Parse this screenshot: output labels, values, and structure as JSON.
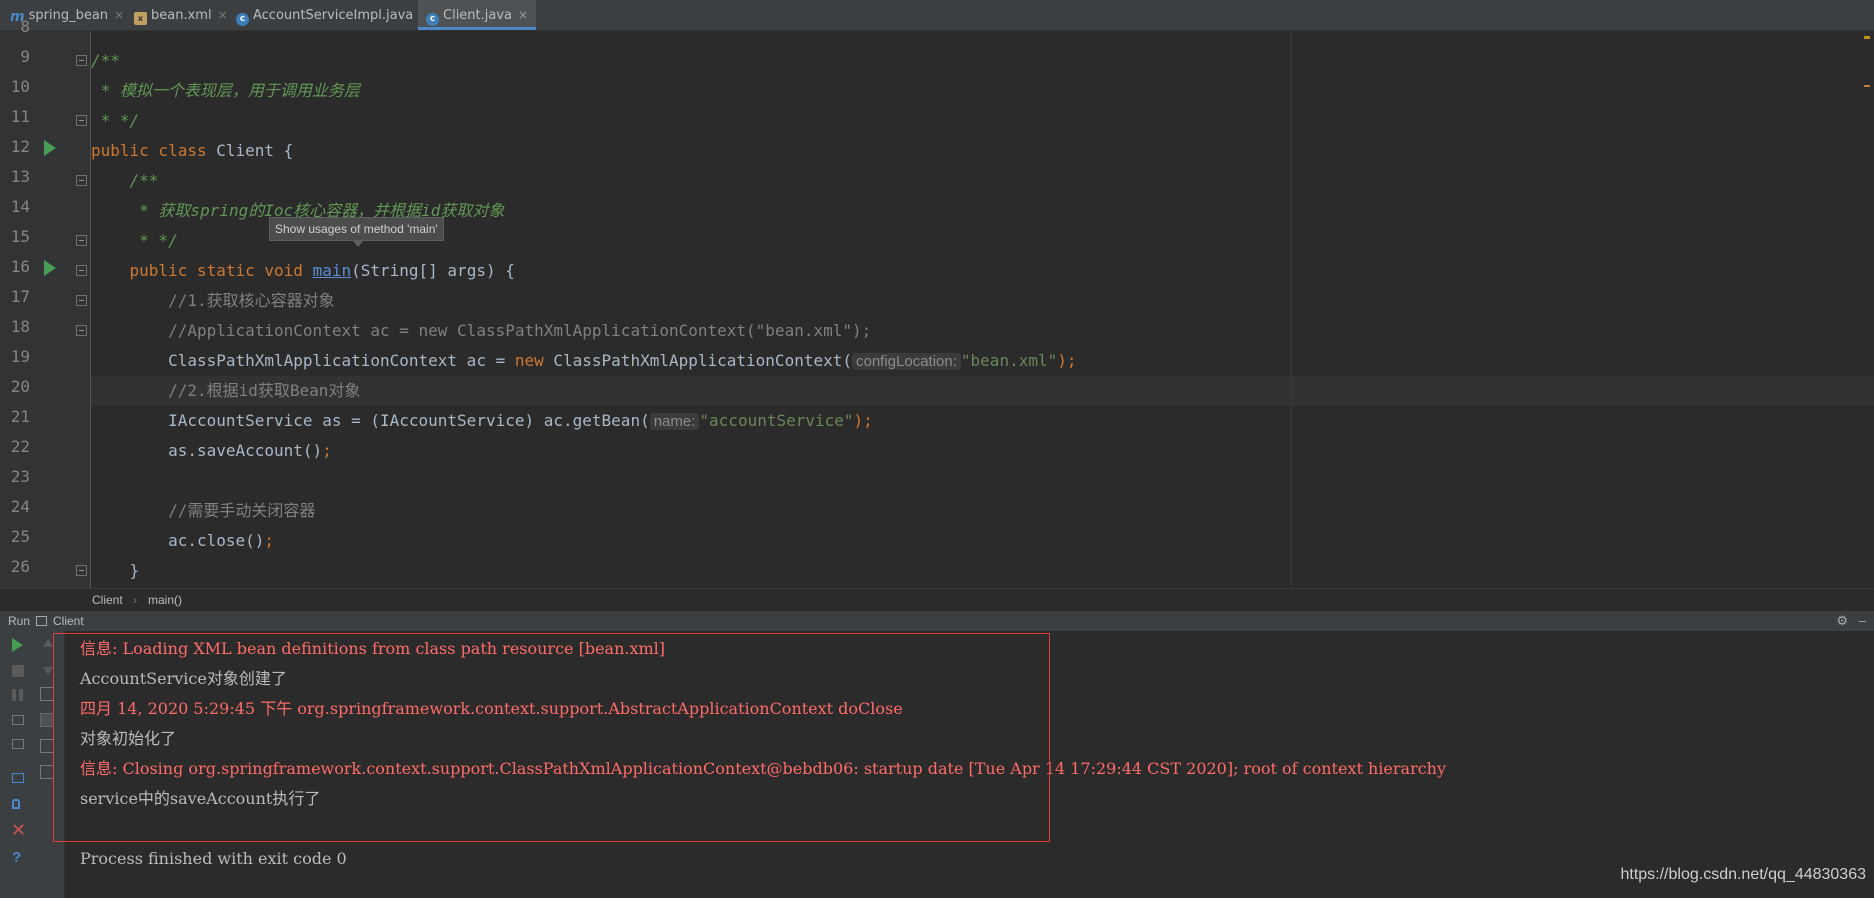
{
  "tabs": [
    {
      "label": "spring_bean",
      "icon": "module-icon",
      "active": false
    },
    {
      "label": "bean.xml",
      "icon": "xml-file-icon",
      "active": false
    },
    {
      "label": "AccountServiceImpl.java",
      "icon": "java-class-icon",
      "active": false
    },
    {
      "label": "Client.java",
      "icon": "java-class-icon",
      "active": true
    }
  ],
  "tab_close_glyph": "×",
  "editor": {
    "line_numbers": [
      "9",
      "10",
      "11",
      "12",
      "13",
      "14",
      "15",
      "16",
      "17",
      "18",
      "19",
      "20",
      "21",
      "22",
      "23",
      "24",
      "25",
      "26"
    ],
    "partial_line_number": "8",
    "lines": {
      "l9": "/**",
      "l10": " * 模拟一个表现层，用于调用业务层",
      "l11": " * */",
      "l12_a": "public class ",
      "l12_b": "Client {",
      "l13": "    /**",
      "l14": "     * 获取spring的Ioc核心容器，并根据id获取对象",
      "l15": "     * */",
      "l16_a": "    public static void ",
      "l16_b": "main",
      "l16_c": "(String[] args) {",
      "l17": "        //1.获取核心容器对象",
      "l18": "        //ApplicationContext ac = new ClassPathXmlApplicationContext(\"bean.xml\");",
      "l19_a": "        ClassPathXmlApplicationContext ac = ",
      "l19_b": "new ",
      "l19_c": "ClassPathXmlApplicationContext(",
      "l19_hint": "configLocation:",
      "l19_str": "\"bean.xml\"",
      "l19_end": ");",
      "l20": "        //2.根据id获取Bean对象",
      "l21_a": "        IAccountService as = (IAccountService) ac.getBean(",
      "l21_hint": "name:",
      "l21_str": "\"accountService\"",
      "l21_end": ");",
      "l22_a": "        as.saveAccount()",
      "l22_b": ";",
      "l23": "",
      "l24": "        //需要手动关闭容器",
      "l25_a": "        ac.close()",
      "l25_b": ";",
      "l26": "    }"
    },
    "tooltip": "Show usages of method 'main'"
  },
  "breadcrumb": {
    "item1": "Client",
    "separator": "›",
    "item2": "main()"
  },
  "run_panel": {
    "label": "Run",
    "tab": "Client",
    "gear": "⚙",
    "minimize": "–"
  },
  "console": {
    "line1": "信息: Loading XML bean definitions from class path resource [bean.xml]",
    "line2": "AccountService对象创建了",
    "line3": "四月 14, 2020 5:29:45 下午 org.springframework.context.support.AbstractApplicationContext doClose",
    "line4": "对象初始化了",
    "line5": "信息: Closing org.springframework.context.support.ClassPathXmlApplicationContext@bebdb06: startup date [Tue Apr 14 17:29:44 CST 2020]; root of context hierarchy",
    "line6": "service中的saveAccount执行了",
    "line8": "Process finished with exit code 0"
  },
  "watermark": "https://blog.csdn.net/qq_44830363",
  "colors": {
    "keyword": "#cc7832",
    "doc_comment": "#629755",
    "line_comment": "#808080",
    "string": "#6a8759",
    "error_text": "#ff6b68",
    "highlight_box": "#e03a3a"
  }
}
